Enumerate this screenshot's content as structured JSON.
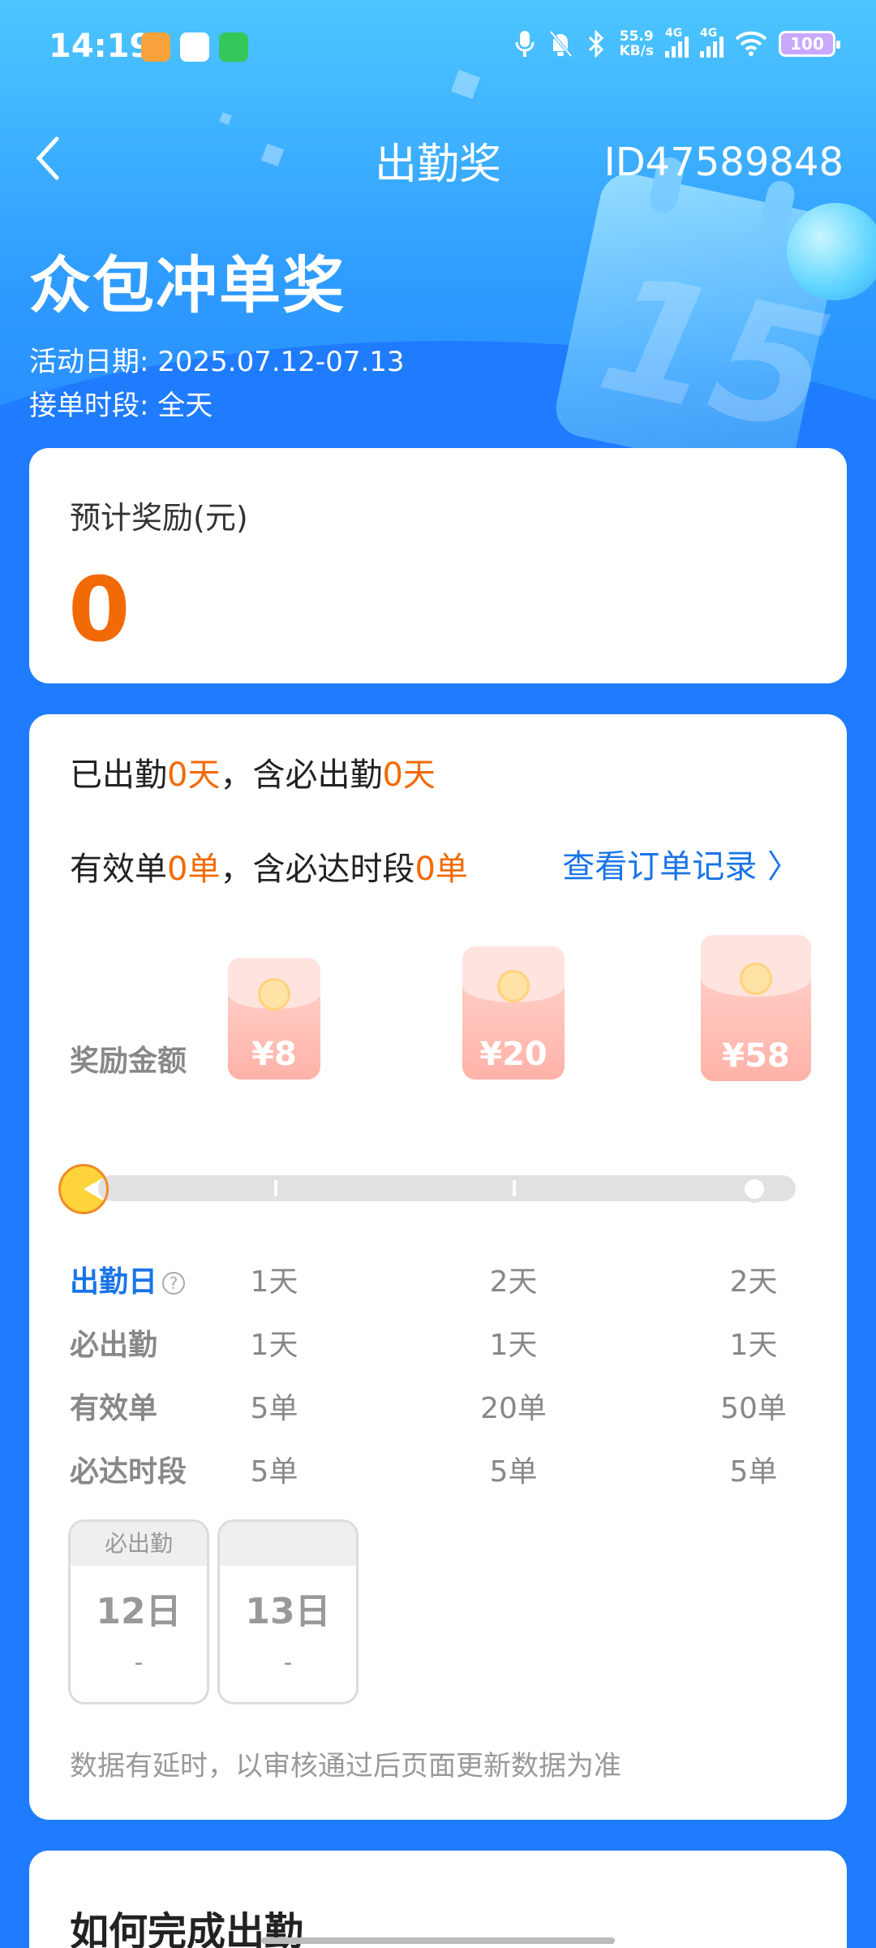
{
  "status_bar": {
    "time": "14:19",
    "net_speed_value": "55.9",
    "net_speed_unit": "KB/s",
    "sim1": "4G",
    "sim2": "4G",
    "battery": "100"
  },
  "nav": {
    "title": "出勤奖",
    "user_id": "ID47589848"
  },
  "hero": {
    "title": "众包冲单奖",
    "date_line": "活动日期: 2025.07.12-07.13",
    "period_line": "接单时段: 全天"
  },
  "estimate": {
    "label": "预计奖励(元)",
    "value": "0"
  },
  "progress": {
    "attend_prefix": "已出勤",
    "attend_days": "0天",
    "attend_mid": "，含必出勤",
    "required_days": "0天",
    "orders_prefix": "有效单",
    "orders_count": "0单",
    "orders_mid": "，含必达时段",
    "required_orders": "0单",
    "link": "查看订单记录 〉"
  },
  "rewards": {
    "label": "奖励金额",
    "tiers": [
      "¥8",
      "¥20",
      "¥58"
    ],
    "fraction": 0
  },
  "table": {
    "headers": [
      "出勤日",
      "必出勤",
      "有效单",
      "必达时段"
    ],
    "rows": [
      [
        "1天",
        "2天",
        "2天"
      ],
      [
        "1天",
        "1天",
        "1天"
      ],
      [
        "5单",
        "20单",
        "50单"
      ],
      [
        "5单",
        "5单",
        "5单"
      ]
    ]
  },
  "days": [
    {
      "tag": "必出勤",
      "day": "12日",
      "value": "-"
    },
    {
      "tag": "",
      "day": "13日",
      "value": "-"
    }
  ],
  "note": "数据有延时，以审核通过后页面更新数据为准",
  "section": {
    "title": "如何完成出勤"
  },
  "colors": {
    "accent": "#1a74e8",
    "highlight": "#f26a06",
    "page_bg": "#1f7cff"
  }
}
